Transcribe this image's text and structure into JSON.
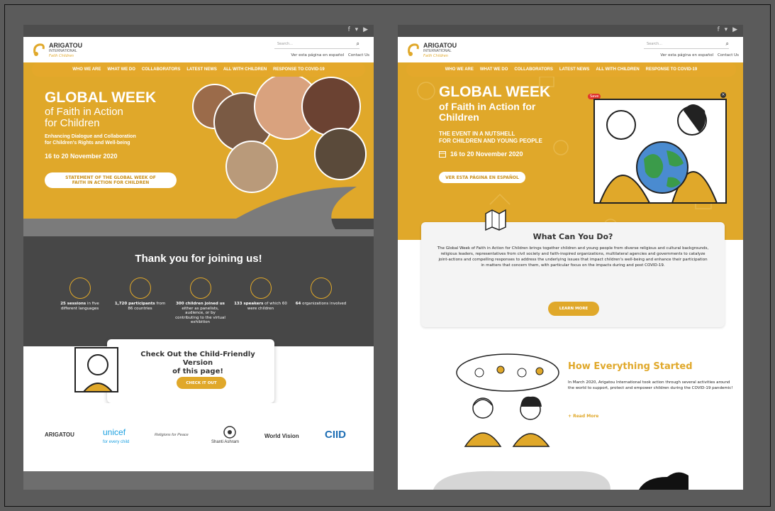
{
  "colors": {
    "brand_yellow": "#e0a82a",
    "dark_gray": "#4d4d4d",
    "panel_gray": "#7d7d7d"
  },
  "left_page": {
    "social_icons": "f ▾ ▶",
    "logo": {
      "name": "ARIGATOU",
      "sub": "INTERNATIONAL",
      "tag": "Faith Children"
    },
    "search_placeholder": "Search...",
    "header_links": [
      "Ver esta página en español",
      "Contact Us"
    ],
    "nav": [
      "WHO WE ARE",
      "WHAT WE DO",
      "COLLABORATORS",
      "LATEST NEWS",
      "ALL WITH CHILDREN",
      "RESPONSE TO COVID-19"
    ],
    "hero": {
      "title": "GLOBAL WEEK",
      "subtitle_line1": "of Faith in Action",
      "subtitle_line2": "for Children",
      "tagline_line1": "Enhancing Dialogue and Collaboration",
      "tagline_line2": "for Children's Rights and Well-being",
      "dates": "16 to 20 November 2020",
      "button_line1": "STATEMENT OF THE GLOBAL WEEK OF",
      "button_line2": "FAITH IN ACTION FOR CHILDREN"
    },
    "thanks_heading": "Thank you for joining us!",
    "stats": [
      {
        "bold": "25 sessions",
        "text": "in five different languages"
      },
      {
        "bold": "1,720 participants",
        "text": "from 86 countries"
      },
      {
        "bold": "300 children joined us",
        "text": "either as panelists, audience, or by contributing to the virtual exhibition"
      },
      {
        "bold": "133 speakers",
        "text": "of which 60 were children"
      },
      {
        "bold": "64",
        "text": "organizations involved"
      }
    ],
    "child_card": {
      "title_line1": "Check Out the Child-Friendly Version",
      "title_line2": "of this page!",
      "button": "CHECK IT OUT"
    },
    "partners": [
      "ARIGATOU",
      "unicef",
      "for every child",
      "Religions for Peace",
      "Shanti Ashram",
      "World Vision",
      "CIID"
    ]
  },
  "right_page": {
    "social_icons": "f ▾ ▶",
    "logo": {
      "name": "ARIGATOU",
      "sub": "INTERNATIONAL",
      "tag": "Faith Children"
    },
    "search_placeholder": "Search...",
    "header_links": [
      "Ver esta página en español",
      "Contact Us"
    ],
    "nav": [
      "WHO WE ARE",
      "WHAT WE DO",
      "COLLABORATORS",
      "LATEST NEWS",
      "ALL WITH CHILDREN",
      "RESPONSE TO COVID-19"
    ],
    "hero": {
      "title": "GLOBAL WEEK",
      "subtitle_line1": "of Faith in Action for",
      "subtitle_line2": "Children",
      "nutshell_line1": "THE EVENT IN A NUTSHELL",
      "nutshell_line2": "FOR CHILDREN AND YOUNG PEOPLE",
      "dates": "16 to 20 November 2020",
      "button": "VER ESTA PÁGINA EN ESPAÑOL",
      "save_badge": "Save"
    },
    "what_card": {
      "heading": "What Can You Do?",
      "body": "The Global Week of Faith in Action for Children brings together children and young people from diverse religious and cultural backgrounds, religious leaders, representatives from civil society and faith-inspired organizations, multilateral agencies and governments to catalyze joint-actions and compelling responses to address the underlying issues that impact children's well-being and enhance their participation in matters that concern them, with particular focus on the impacts during and post COVID-19.",
      "button": "LEARN MORE"
    },
    "how": {
      "heading": "How Everything Started",
      "body": "In March 2020, Arigatou International took action through several activities around the world to support, protect and empower children during the COVID-19 pandemic!",
      "link": "+ Read More"
    }
  }
}
